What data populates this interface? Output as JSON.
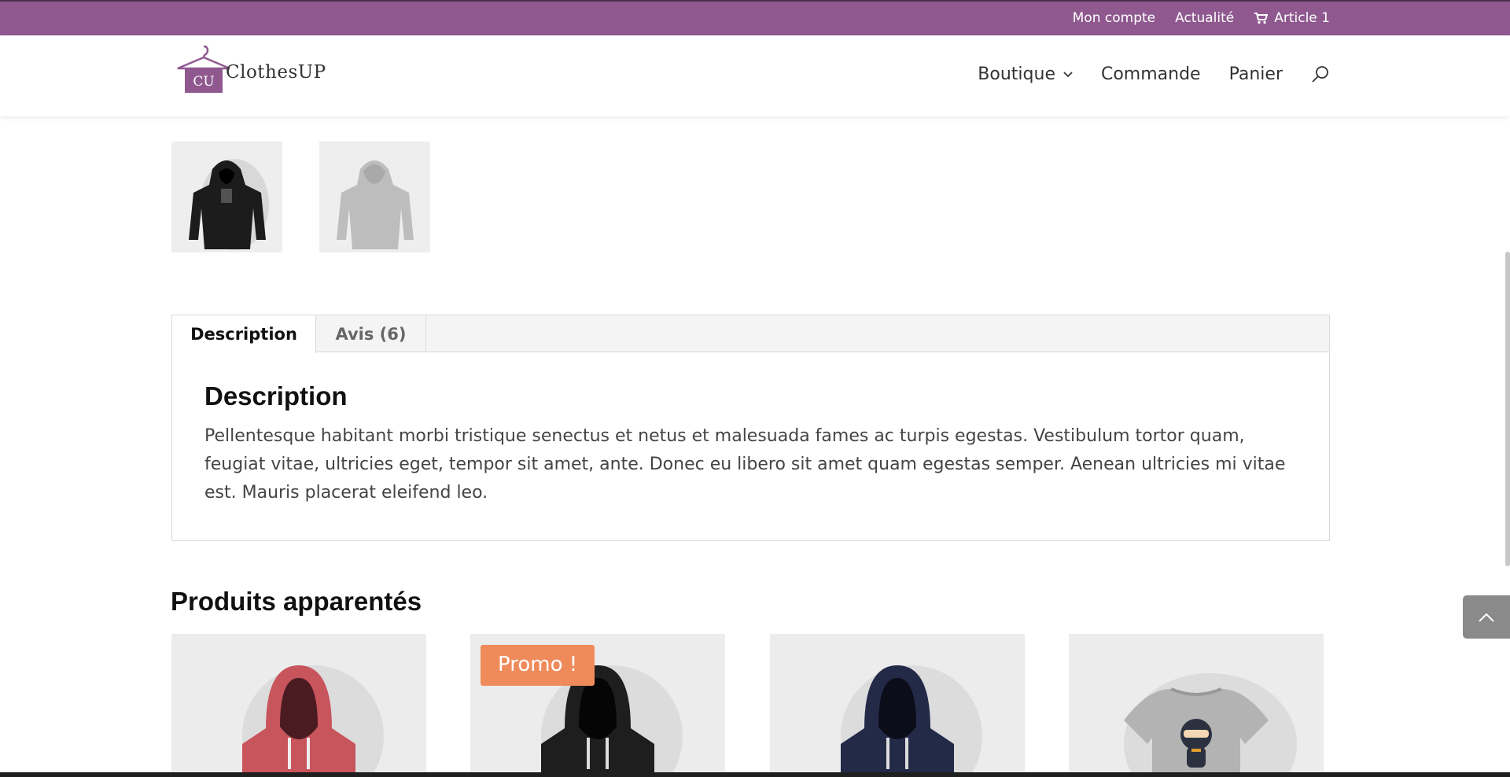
{
  "topbar": {
    "links": [
      "Mon compte",
      "Actualité"
    ],
    "cart_label": "Article 1"
  },
  "brand": {
    "logo_text": "ClothesUP",
    "logo_monogram": "CU",
    "accent": "#8f5990"
  },
  "nav": {
    "items": [
      {
        "label": "Boutique",
        "has_dropdown": true
      },
      {
        "label": "Commande"
      },
      {
        "label": "Panier"
      }
    ],
    "search_icon": "search-icon"
  },
  "gallery": {
    "thumbnails": [
      {
        "alt": "hoodie-black-thumbnail"
      },
      {
        "alt": "hoodie-grey-back-thumbnail"
      }
    ]
  },
  "tabs": {
    "items": [
      {
        "label": "Description",
        "active": true
      },
      {
        "label": "Avis (6)",
        "active": false
      }
    ],
    "panel": {
      "heading": "Description",
      "body": "Pellentesque habitant morbi tristique senectus et netus et malesuada fames ac turpis egestas. Vestibulum tortor quam, feugiat vitae, ultricies eget, tempor sit amet, ante. Donec eu libero sit amet quam egestas semper. Aenean ultricies mi vitae est. Mauris placerat eleifend leo."
    }
  },
  "related": {
    "title": "Produits apparentés",
    "products": [
      {
        "kind": "hoodie",
        "color": "#c8545c",
        "promo": false
      },
      {
        "kind": "hoodie",
        "color": "#1e1e1e",
        "promo": true,
        "promo_label": "Promo !"
      },
      {
        "kind": "hoodie",
        "color": "#232a48",
        "promo": false
      },
      {
        "kind": "tshirt",
        "color": "#b3b3b3",
        "promo": false
      }
    ],
    "promo_color": "#ef8b5b"
  }
}
